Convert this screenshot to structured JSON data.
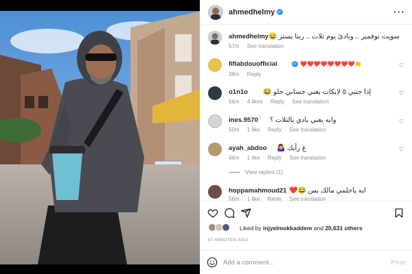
{
  "post": {
    "author": "ahmedhelmy",
    "caption_author": "ahmedhelmy",
    "caption_text": "سويت نوفمبر .. وبادئ يوم تلات .. ربنا يستر 😄",
    "caption_time": "57m",
    "see_translation": "See translation"
  },
  "comments": [
    {
      "user": "fifiabdouofficial",
      "text": "❤️❤️❤️❤️❤️❤️❤️❤️👏",
      "time": "38m",
      "likes": "",
      "reply": "Reply",
      "translate": ""
    },
    {
      "user": "o1n1o",
      "text": "إذا جتني ٥ لايكات يعني حسابي حلو 😂",
      "time": "56m",
      "likes": "4 likes",
      "reply": "Reply",
      "translate": "See translation"
    },
    {
      "user": "ines.9570",
      "text": "وايه يعني بادي بالتلات ؟",
      "time": "50m",
      "likes": "1 like",
      "reply": "Reply",
      "translate": "See translation"
    },
    {
      "user": "ayah_abdoo",
      "text": "🤷‍♀️ غ رأيك",
      "time": "46m",
      "likes": "1 like",
      "reply": "Reply",
      "translate": "See translation"
    },
    {
      "user": "hoppamahmoud21",
      "text": "ايه ياحلمي مالك بس 😂❤️",
      "time": "56m",
      "likes": "1 like",
      "reply": "Reply",
      "translate": "See translation"
    }
  ],
  "view_replies": "View replies (1)",
  "likes": {
    "prefix": "Liked by",
    "user": "injyelmokkaddem",
    "middle": "and",
    "count": "20,631 others"
  },
  "posted_ago": "57 MINUTES AGO",
  "add_comment": {
    "placeholder": "Add a comment...",
    "post_label": "Post"
  },
  "icons": {
    "more": "more-options-icon",
    "verified": "verified-badge-icon",
    "like": "heart-icon",
    "comment": "comment-icon",
    "share": "share-icon",
    "save": "bookmark-icon",
    "emoji": "emoji-icon"
  },
  "colors": {
    "accent": "#3897f0",
    "post_button": "#b2dffc",
    "muted": "#8e8e8e",
    "heart_red": "#ed4956"
  }
}
